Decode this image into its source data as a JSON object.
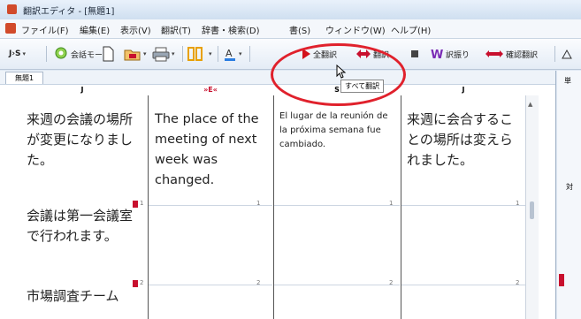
{
  "window": {
    "title": "翻訳エディタ - [無題1]"
  },
  "menubar": {
    "items": [
      "ファイル(F)",
      "編集(E)",
      "表示(V)",
      "翻訳(T)",
      "辞書・検索(D)",
      "書(S)",
      "ウィンドウ(W)",
      "ヘルプ(H)"
    ]
  },
  "toolbar": {
    "lang_pair": "J›S",
    "conversation_mode": "会話モード",
    "translate_all": "全翻訳",
    "translate": "翻訳",
    "stop_label": "",
    "translation_memory": "訳振り",
    "confirm_translation": "確認翻訳"
  },
  "tooltip": {
    "text": "すべて翻訳"
  },
  "document": {
    "tab": "無題1",
    "headers": [
      "J",
      "»E«",
      "S",
      "J"
    ],
    "rows": [
      {
        "num": "1",
        "cells": [
          "来週の会議の場所が変更になりました。",
          "The place of the meeting of next week was changed.",
          "El lugar de la reunión de la próxima semana fue cambiado.",
          "来週に会合することの場所は変えられました。"
        ]
      },
      {
        "num": "2",
        "cells": [
          "会議は第一会議室で行われます。",
          "",
          "",
          ""
        ]
      },
      {
        "num": "",
        "cells": [
          "市場調査チーム",
          "",
          "",
          ""
        ]
      }
    ]
  },
  "right_panel": {
    "label1": "単",
    "label2": "対"
  },
  "colors": {
    "highlight_circle": "#e0212c",
    "row_marker": "#c8102e"
  }
}
